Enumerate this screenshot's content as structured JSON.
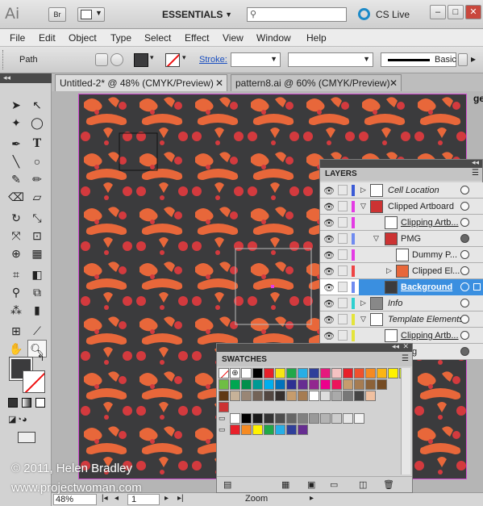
{
  "app": {
    "logo": "Ai",
    "bridge_label": "Br",
    "workspace": "ESSENTIALS",
    "search_placeholder": "",
    "cs_live": "CS Live"
  },
  "menu": [
    "File",
    "Edit",
    "Object",
    "Type",
    "Select",
    "Effect",
    "View",
    "Window",
    "Help"
  ],
  "control": {
    "selection_label": "Path",
    "stroke_label": "Stroke:",
    "style_label": "Basic"
  },
  "tabs": [
    {
      "label": "Untitled-2* @ 48% (CMYK/Preview)",
      "active": true
    },
    {
      "label": "pattern8.ai @ 60% (CMYK/Preview)",
      "active": false
    }
  ],
  "status": {
    "zoom": "48%",
    "artboard": "1",
    "mode": "Zoom"
  },
  "layers_panel": {
    "title": "LAYERS",
    "rows": [
      {
        "name": "Cell Location",
        "italic": true,
        "color": "#3b5bd6"
      },
      {
        "name": "Clipped Artboard",
        "italic": false,
        "color": "#e43be4"
      },
      {
        "name": "Clipping Artb...",
        "italic": false,
        "color": "#e43be4"
      },
      {
        "name": "PMG",
        "italic": false,
        "color": "#6f8bf0"
      },
      {
        "name": "Dummy P...",
        "italic": false,
        "color": "#e43be4"
      },
      {
        "name": "Clipped El...",
        "italic": false,
        "color": "#e44"
      },
      {
        "name": "Background",
        "italic": false,
        "color": "#6f8bf0",
        "selected": true
      },
      {
        "name": "Info",
        "italic": true,
        "color": "#2ed0d0"
      },
      {
        "name": "Template Elements",
        "italic": true,
        "color": "#e4e43b"
      },
      {
        "name": "Clipping Artb...",
        "italic": false,
        "color": "#e4e43b"
      },
      {
        "name": "g",
        "italic": false,
        "color": "#e4e43b"
      }
    ]
  },
  "swatches_panel": {
    "title": "SWATCHES",
    "row1": [
      "#ffffff",
      "#000000",
      "#e8202a",
      "#f7e613",
      "#21a84a",
      "#27aee6",
      "#2f3f9a",
      "#e5197d",
      "#f4c2c2",
      "#e8202a",
      "#f0512d",
      "#f58a22",
      "#fbb514",
      "#fff200",
      "#c5d72f"
    ],
    "row2": [
      "#6fbe44",
      "#00a651",
      "#008f4c",
      "#009a94",
      "#00aeef",
      "#0072bc",
      "#2e3192",
      "#662d91",
      "#92278f",
      "#ec008c",
      "#ed145b",
      "#c69c6d",
      "#a67c52",
      "#8c6239",
      "#754c24"
    ],
    "row3": [
      "#603913",
      "#c7b299",
      "#998675",
      "#736357",
      "#534741",
      "#362f2d",
      "#c69c6d",
      "#a67c52",
      "#ffffff",
      "#dddddd",
      "#aaaaaa",
      "#777777",
      "#444444",
      "#f0c0a0"
    ],
    "gray_row": [
      "#ffffff",
      "#000000",
      "#1a1a1a",
      "#333333",
      "#4d4d4d",
      "#666666",
      "#808080",
      "#999999",
      "#b3b3b3",
      "#cccccc",
      "#e6e6e6",
      "#f2f2f2"
    ],
    "color_row": [
      "#e8202a",
      "#f58a22",
      "#fff200",
      "#21a84a",
      "#27aee6",
      "#2f3f9a",
      "#662d91"
    ]
  },
  "watermark": {
    "copyright": "© 2011, Helen Bradley",
    "url": "www.projectwoman.com"
  },
  "canvas_overflow_text": "ge"
}
